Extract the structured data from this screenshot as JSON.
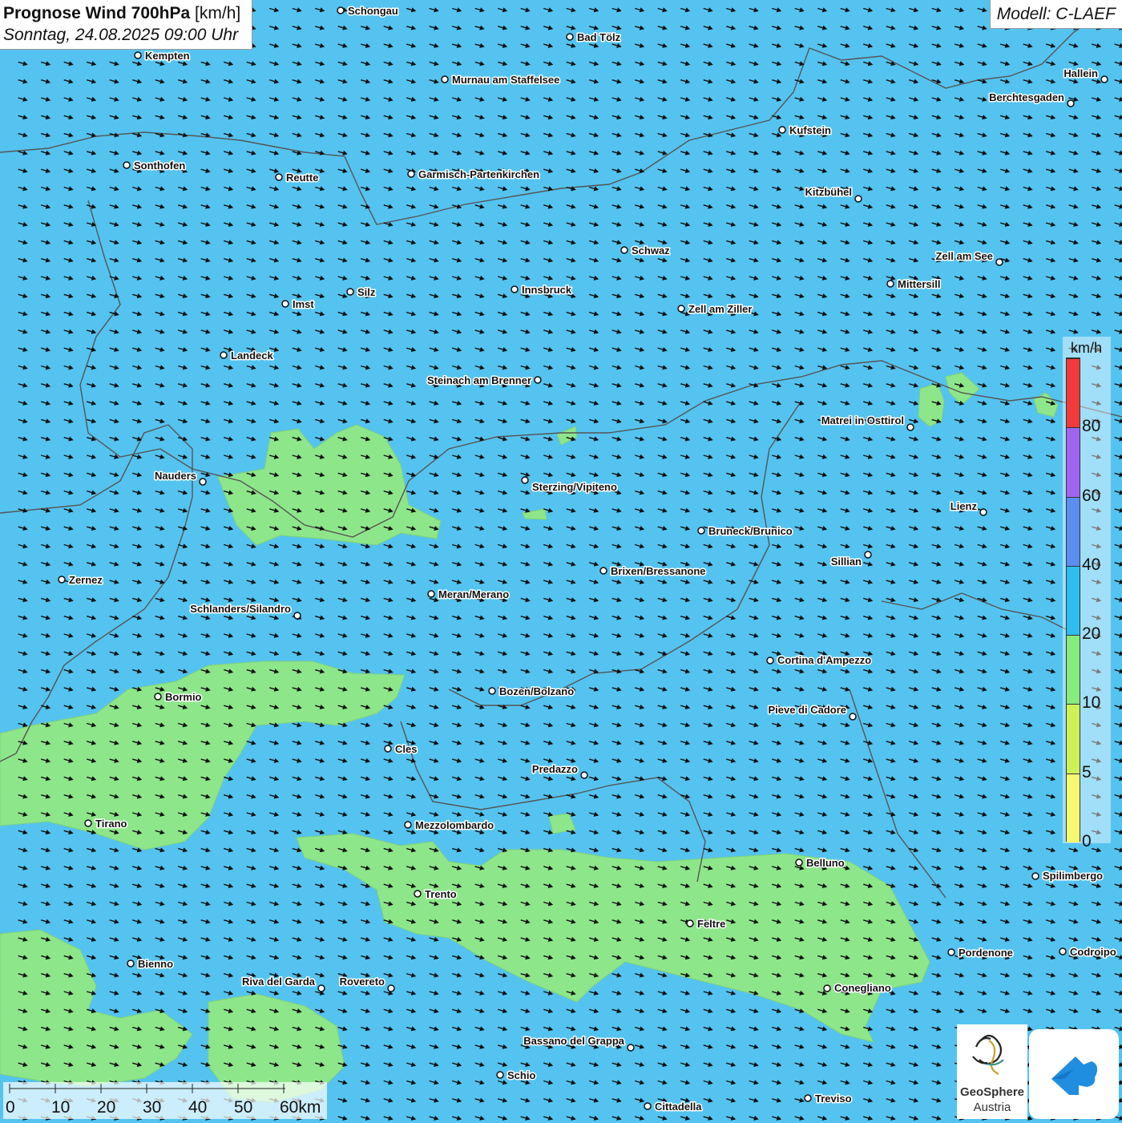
{
  "header": {
    "title": "Prognose Wind 700hPa",
    "unit": "[km/h]",
    "datetime": "Sonntag, 24.08.2025 09:00 Uhr",
    "model": "Modell: C-LAEF"
  },
  "legend": {
    "unit": "km/h",
    "ticks": [
      "80",
      "60",
      "40",
      "20",
      "10",
      "5",
      "0"
    ],
    "colors": [
      "#f23a3a",
      "#a065f0",
      "#5a8ef0",
      "#2ebdf0",
      "#86ec7c",
      "#ccf255",
      "#f8f870"
    ]
  },
  "colors": {
    "background": "#55c3f0",
    "light_wind": "#8ee68a",
    "arrow": "#111111",
    "border": "#555555"
  },
  "wind": {
    "speed_class": "10-20",
    "direction": "from WNW"
  },
  "scale": {
    "labels": [
      "0",
      "10",
      "20",
      "30",
      "40",
      "50",
      "60km"
    ]
  },
  "logo": {
    "name_line1": "GeoSphere",
    "name_line2": "Austria",
    "icon": "geosphere-logo-icon",
    "app_icon": "cloud-arrow-app-icon"
  },
  "cities": [
    {
      "name": "Schongau"
    },
    {
      "name": "Bad Tölz"
    },
    {
      "name": "Kempten"
    },
    {
      "name": "Murnau am Staffelsee"
    },
    {
      "name": "Hallein"
    },
    {
      "name": "Berchtesgaden"
    },
    {
      "name": "Kufstein"
    },
    {
      "name": "Sonthofen"
    },
    {
      "name": "Reutte"
    },
    {
      "name": "Garmisch-Partenkirchen"
    },
    {
      "name": "Kitzbühel"
    },
    {
      "name": "Schwaz"
    },
    {
      "name": "Zell am See"
    },
    {
      "name": "Mittersill"
    },
    {
      "name": "Innsbruck"
    },
    {
      "name": "Silz"
    },
    {
      "name": "Imst"
    },
    {
      "name": "Zell am Ziller"
    },
    {
      "name": "Landeck"
    },
    {
      "name": "Steinach am Brenner"
    },
    {
      "name": "Matrei in Osttirol"
    },
    {
      "name": "Nauders"
    },
    {
      "name": "Sterzing/Vipiteno"
    },
    {
      "name": "Lienz"
    },
    {
      "name": "Bruneck/Brunico"
    },
    {
      "name": "Sillian"
    },
    {
      "name": "Zernez"
    },
    {
      "name": "Brixen/Bressanone"
    },
    {
      "name": "Meran/Merano"
    },
    {
      "name": "Schlanders/Silandro"
    },
    {
      "name": "Cortina d'Ampezzo"
    },
    {
      "name": "Bormio"
    },
    {
      "name": "Bozen/Bolzano"
    },
    {
      "name": "Pieve di Cadore"
    },
    {
      "name": "Cles"
    },
    {
      "name": "Predazzo"
    },
    {
      "name": "Tirano"
    },
    {
      "name": "Mezzolombardo"
    },
    {
      "name": "Belluno"
    },
    {
      "name": "Spilimbergo"
    },
    {
      "name": "Trento"
    },
    {
      "name": "Feltre"
    },
    {
      "name": "Pordenone"
    },
    {
      "name": "Codroipo"
    },
    {
      "name": "Bienno"
    },
    {
      "name": "Riva del Garda"
    },
    {
      "name": "Rovereto"
    },
    {
      "name": "Conegliano"
    },
    {
      "name": "Bassano del Grappa"
    },
    {
      "name": "Schio"
    },
    {
      "name": "Treviso"
    },
    {
      "name": "Cittadella"
    }
  ]
}
